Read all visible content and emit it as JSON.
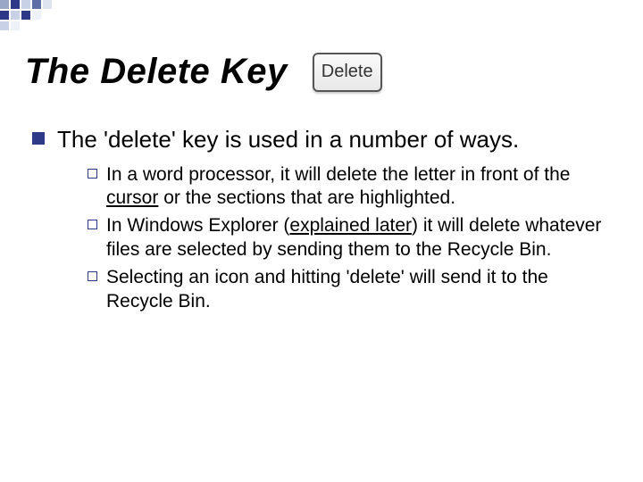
{
  "title": "The Delete Key",
  "keycap_label": "Delete",
  "intro": "The 'delete' key is used in a number of ways.",
  "sub_items": [
    {
      "pre": " In a word processor, it will delete the letter in front of the ",
      "underlined": "cursor",
      "post": " or the sections that are highlighted."
    },
    {
      "pre": " In Windows Explorer (",
      "underlined": "explained later",
      "post": ") it will delete whatever files are selected by sending them to the Recycle Bin."
    },
    {
      "pre": "Selecting an icon and hitting 'delete' will send it to the Recycle Bin.",
      "underlined": "",
      "post": ""
    }
  ],
  "accent_color": "#2e3a87"
}
